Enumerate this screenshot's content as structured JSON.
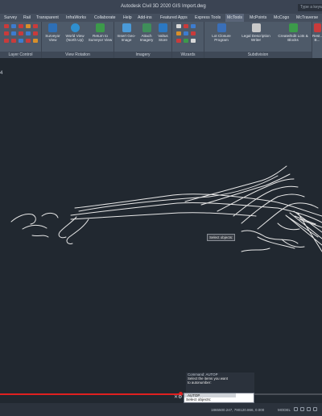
{
  "window": {
    "title": "Autodesk Civil 3D 2020   GIS Import.dwg",
    "search_placeholder": "Type a keyword"
  },
  "tabs": [
    "Survey",
    "Rail",
    "Transparent",
    "InfraWorks",
    "Collaborate",
    "Help",
    "Add-ins",
    "Featured Apps",
    "Express Tools",
    "McTools",
    "McPoints",
    "McCogo",
    "McTraverse"
  ],
  "active_tab": "McTools",
  "ribbon": {
    "panels": {
      "layer_control": "Layer Control",
      "view_rotation": "View Rotation",
      "imagery": "Imagery",
      "wizards": "Wizards",
      "subdivision": "Subdivision"
    },
    "buttons": {
      "surveyor_view": "Surveyor View",
      "world_view": "World View (North Up)",
      "return_to_surveyor_view": "Return to Surveyor View",
      "insert_geo_image": "Insert Geo-Image",
      "attach_imagery": "Attach Imagery",
      "valtus_store": "Valtus Store",
      "lot_closure": "Lot Closure Program",
      "legal_description": "Legal Description Writer",
      "create_edit_lots": "Create/Edit Lots & Blocks",
      "reset": "Rest... B..."
    }
  },
  "viewport": {
    "corner_mark": "4",
    "tooltip": "Select objects:"
  },
  "command": {
    "history": [
      "Command: AUTOP",
      "Select the items you want",
      "to autonumber:"
    ],
    "autocomplete": "AUTOP",
    "prompt": "Select objects:"
  },
  "video_progress": 0.56,
  "status": {
    "coords": "1865500.247, 790120.866, 0.000",
    "model": "MODEL"
  },
  "colors": {
    "viewport_bg": "#212830",
    "ribbon_bg": "#4e5a69",
    "contour": "#e8e8e8",
    "progress": "#e02020"
  }
}
